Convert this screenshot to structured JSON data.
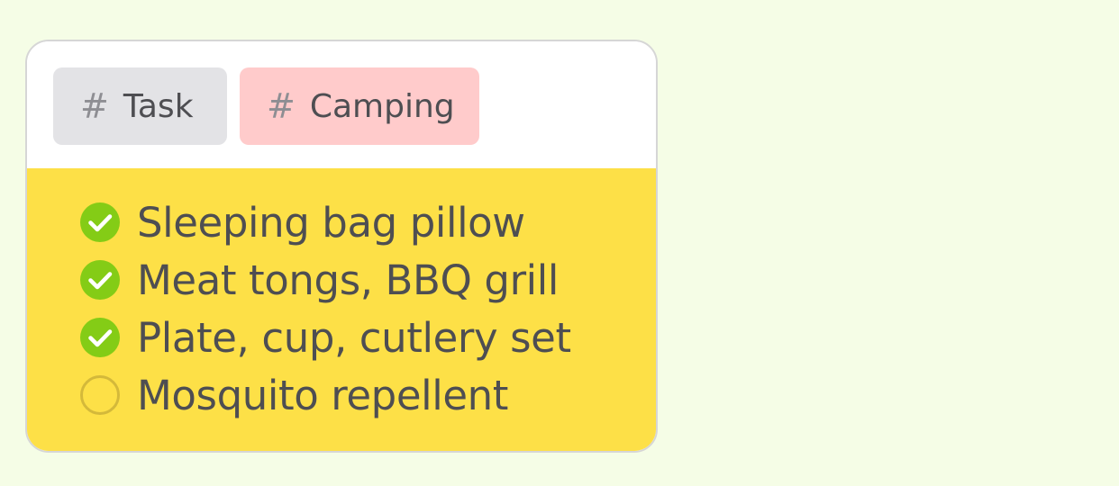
{
  "tags": [
    {
      "symbol": "#",
      "label": "Task",
      "color": "#e3e3e6"
    },
    {
      "symbol": "#",
      "label": "Camping",
      "color": "#ffcbcb"
    }
  ],
  "checklist": {
    "background": "#fde047",
    "items": [
      {
        "text": "Sleeping bag pillow",
        "checked": true,
        "icon": "check-circle-filled-icon"
      },
      {
        "text": "Meat tongs, BBQ grill",
        "checked": true,
        "icon": "check-circle-filled-icon"
      },
      {
        "text": "Plate, cup, cutlery set",
        "checked": true,
        "icon": "check-circle-filled-icon"
      },
      {
        "text": "Mosquito repellent",
        "checked": false,
        "icon": "empty-circle-icon"
      }
    ]
  },
  "colors": {
    "checked": "#84cc16",
    "unchecked_ring": "#d4b93a",
    "page_background": "#f5fde6"
  }
}
